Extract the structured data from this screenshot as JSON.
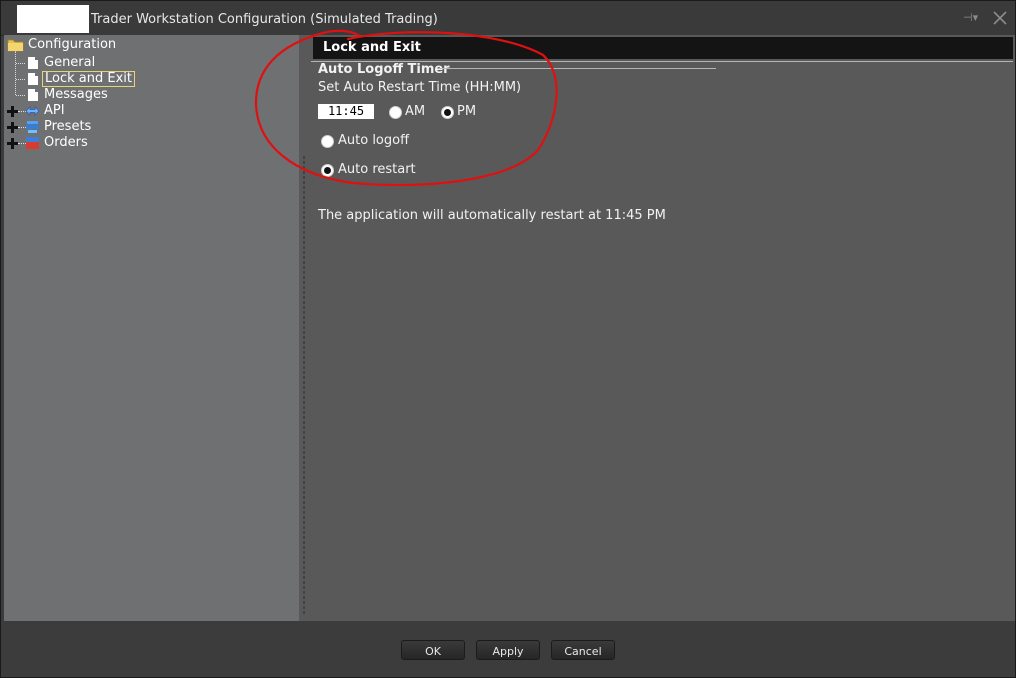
{
  "window": {
    "title": "Trader Workstation Configuration (Simulated Trading)",
    "pin_glyph": "⊣▾",
    "icons": [
      "logo-blank",
      "pin-icon",
      "close-icon"
    ]
  },
  "tree": {
    "root": {
      "label": "Configuration",
      "icon": "folder-icon"
    },
    "items": [
      {
        "label": "General",
        "icon": "doc-icon"
      },
      {
        "label": "Lock and Exit",
        "icon": "doc-icon",
        "selected": true
      },
      {
        "label": "Messages",
        "icon": "doc-icon"
      },
      {
        "label": "API",
        "icon": "api-icon",
        "expandable": true
      },
      {
        "label": "Presets",
        "icon": "presets-icon",
        "expandable": true
      },
      {
        "label": "Orders",
        "icon": "orders-icon",
        "expandable": true
      }
    ]
  },
  "content": {
    "section_title": "Lock and Exit",
    "group_title": "Auto Logoff Timer",
    "restart_time_label": "Set Auto Restart Time (HH:MM)",
    "time_value": "11:45",
    "am_label": "AM",
    "pm_label": "PM",
    "meridiem_selected": "PM",
    "auto_logoff_label": "Auto logoff",
    "auto_restart_label": "Auto restart",
    "mode_selected": "Auto restart",
    "status_message": "The application will automatically restart at 11:45 PM"
  },
  "buttons": {
    "ok": "OK",
    "apply": "Apply",
    "cancel": "Cancel"
  },
  "colors": {
    "annotation": "#e01010",
    "selection_border": "#e8d27a",
    "tree_bg": "#6f7072",
    "content_bg": "#595959"
  }
}
